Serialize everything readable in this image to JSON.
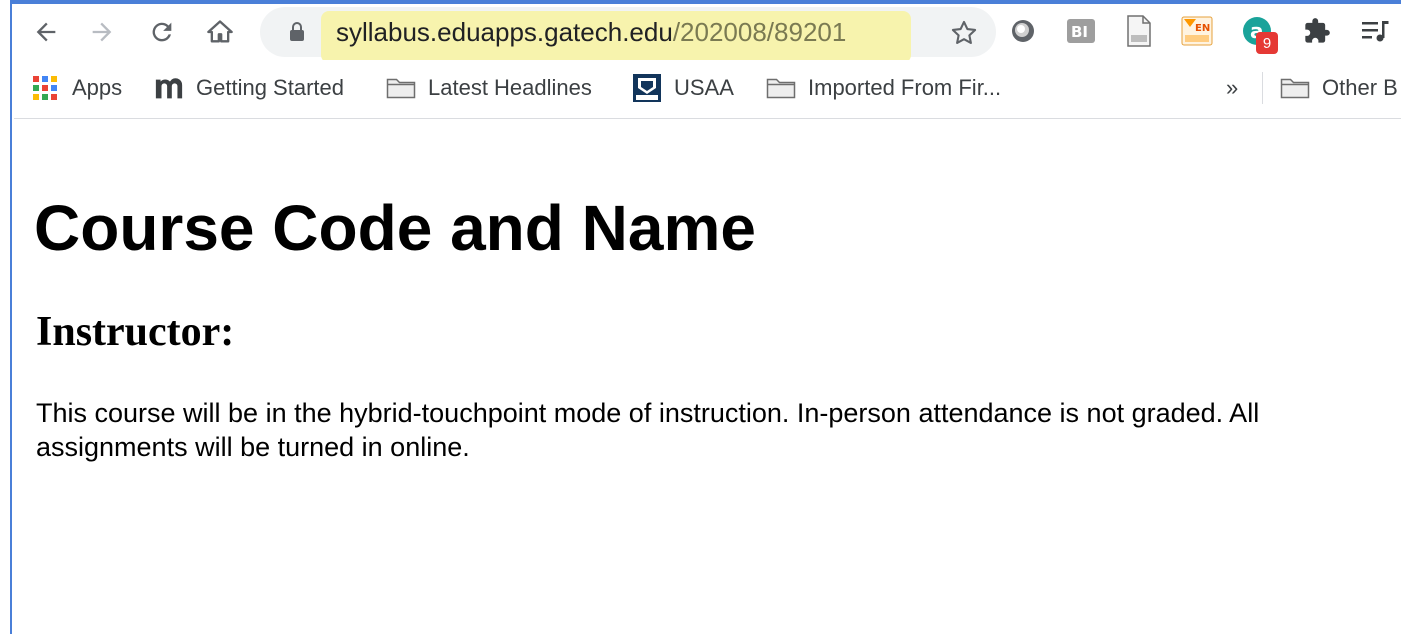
{
  "browser": {
    "url_domain": "syllabus.eduapps.gatech.edu",
    "url_path": "/202008/89201",
    "icons": [
      "back-icon",
      "forward-icon",
      "reload-icon",
      "home-icon",
      "lock-icon",
      "star-icon"
    ],
    "extensions": {
      "badge_count": "9"
    }
  },
  "bookmarks": {
    "items": [
      {
        "label": "Apps",
        "icon": "apps-grid-icon"
      },
      {
        "label": "Getting Started",
        "icon": "m-logo-icon"
      },
      {
        "label": "Latest Headlines",
        "icon": "folder-icon"
      },
      {
        "label": "USAA",
        "icon": "usaa-logo-icon"
      },
      {
        "label": "Imported From Fir...",
        "icon": "folder-icon"
      }
    ],
    "overflow": "»",
    "other": "Other B"
  },
  "page": {
    "title": "Course Code and Name",
    "instructor_heading": "Instructor:",
    "paragraph": "This course will be in the hybrid-touchpoint mode of instruction. In-person attendance is not graded. All assignments will be turned in online."
  },
  "colors": {
    "url_highlight": "#f7f3ad",
    "window_accent": "#4a7fd8",
    "badge": "#e53935"
  }
}
